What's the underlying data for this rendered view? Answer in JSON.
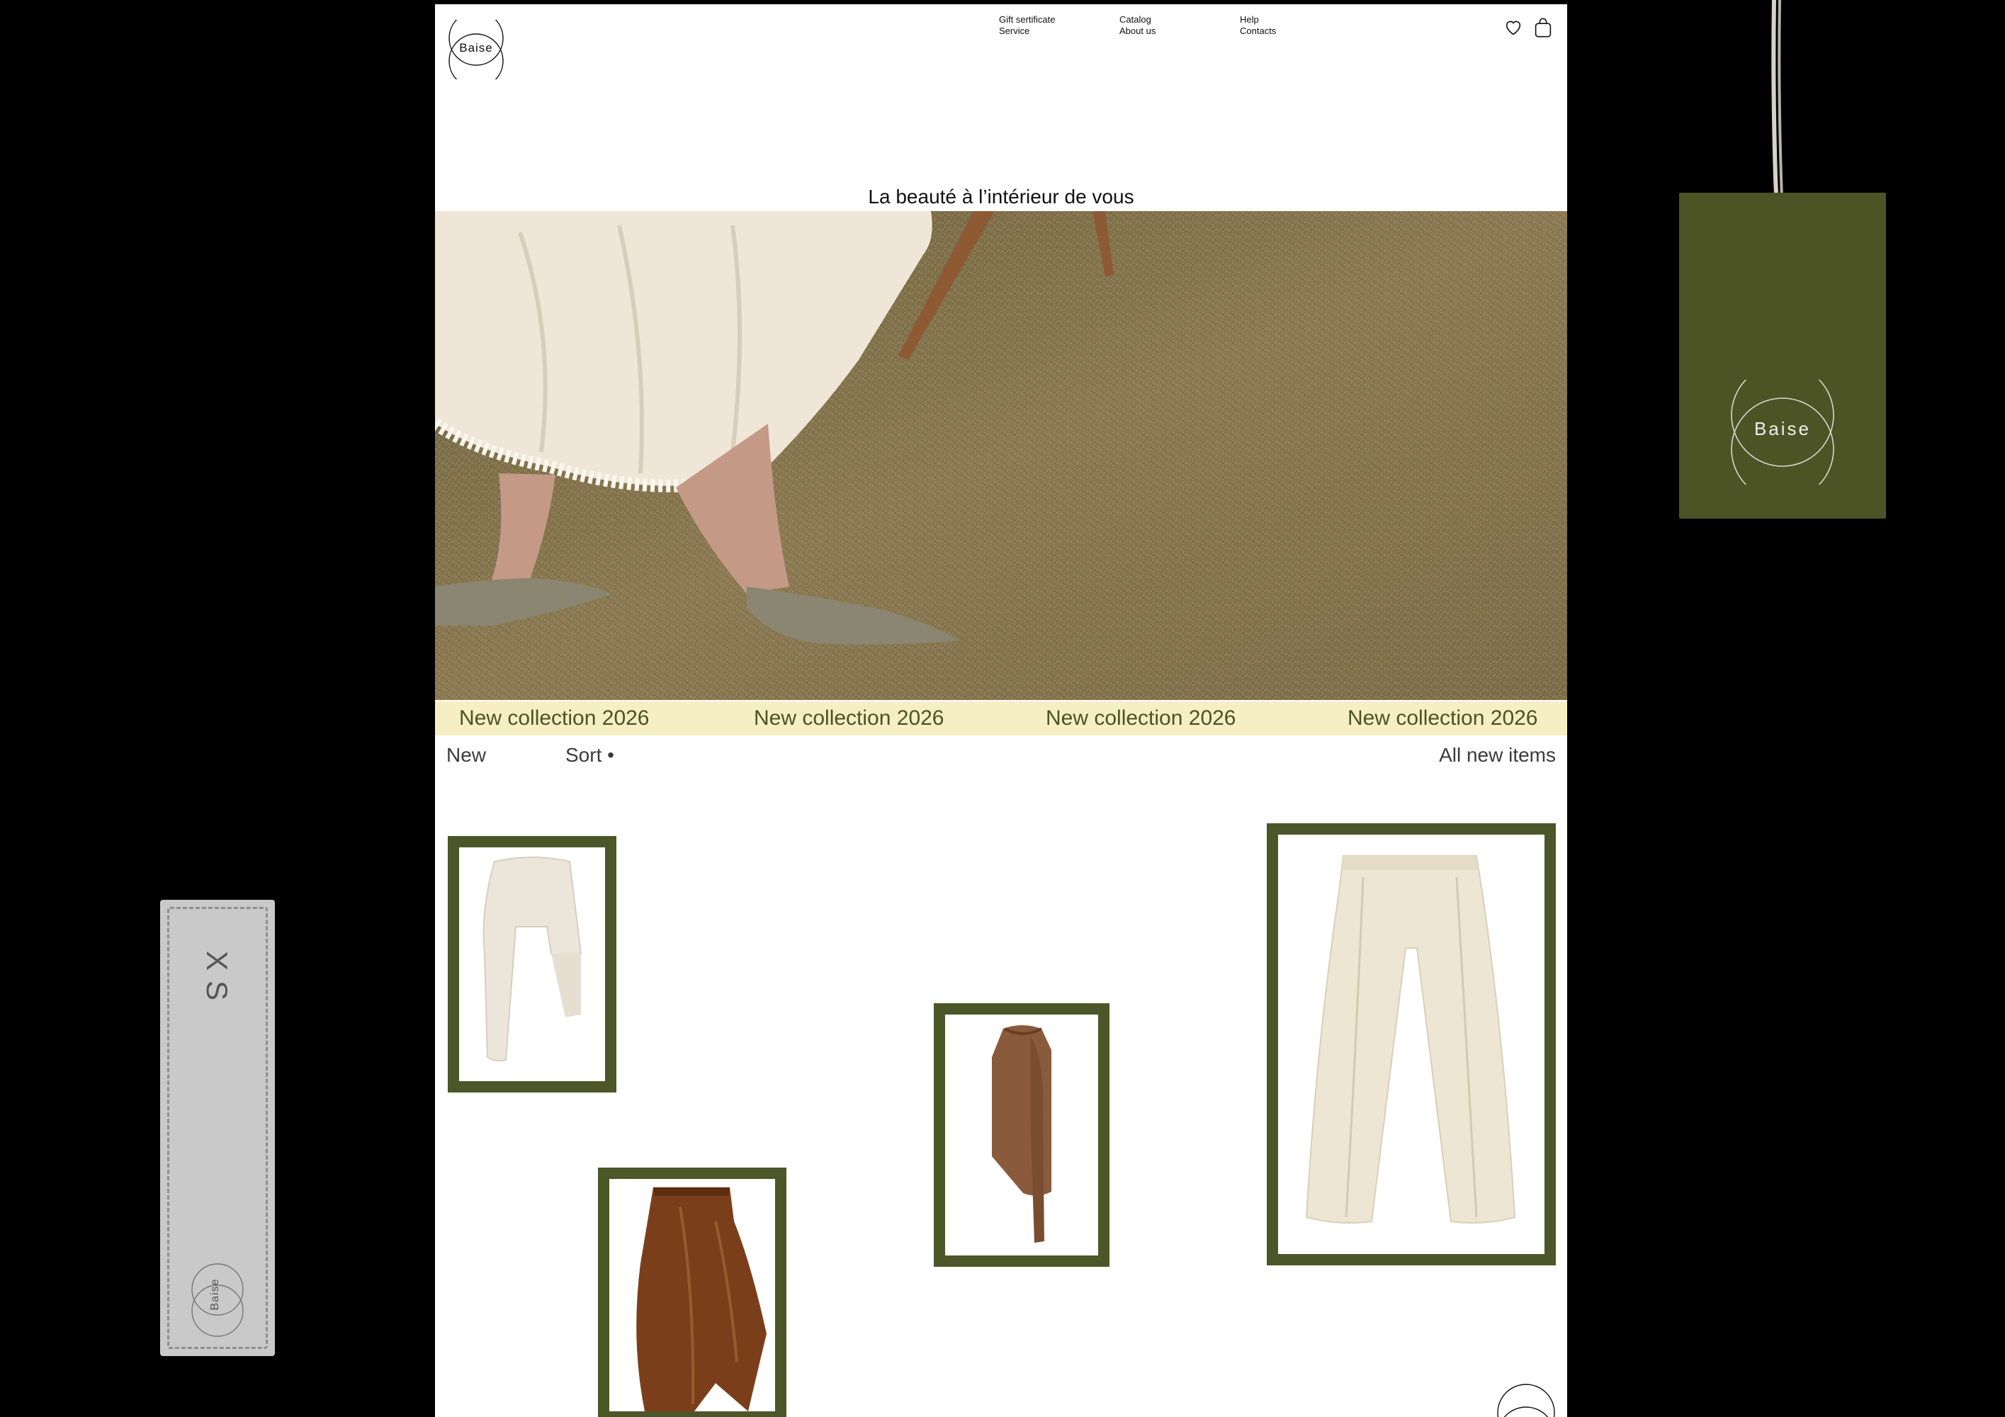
{
  "brand": {
    "name": "Baise"
  },
  "nav": {
    "col1": [
      "Gift sertificate",
      "Service"
    ],
    "col2": [
      "Catalog",
      "About us"
    ],
    "col3": [
      "Help",
      "Contacts"
    ]
  },
  "icons": {
    "wishlist": "heart-icon",
    "cart": "bag-icon"
  },
  "hero": {
    "tagline": "La beauté à l’intérieur de vous"
  },
  "marquee": {
    "items": [
      "New collection 2026",
      "New collection 2026",
      "New collection 2026",
      "New collection 2026"
    ]
  },
  "toolbar": {
    "new_label": "New",
    "sort_label": "Sort •",
    "all_label": "All new items"
  },
  "colors": {
    "olive": "#4d5628",
    "cream_band": "#f6efc3",
    "band_text": "#4b5227"
  },
  "hangtag": {
    "brand": "Baise"
  },
  "size_label": {
    "size": "XS",
    "brand": "Baise"
  }
}
